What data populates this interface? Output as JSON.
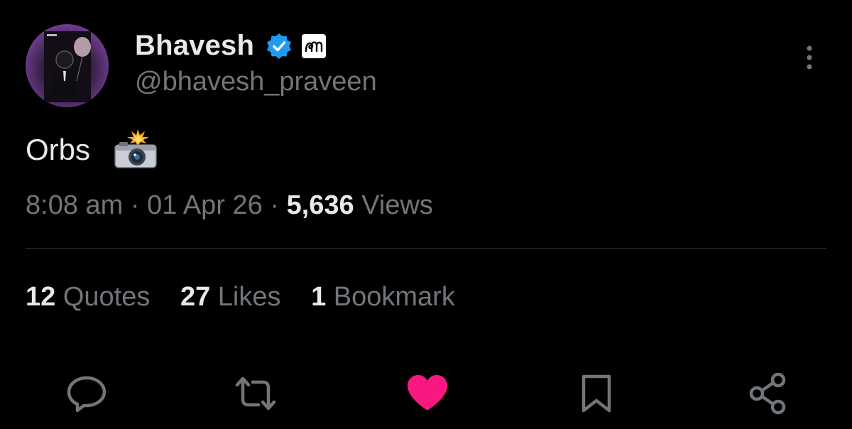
{
  "author": {
    "display_name": "Bhavesh",
    "handle": "@bhavesh_praveen",
    "verified": true,
    "avatar_icon": "avatar-astronaut-with-balloon"
  },
  "tweet": {
    "text": "Orbs",
    "emoji_icon": "camera-with-flash-icon",
    "time": "8:08 am",
    "date": "01 Apr 26",
    "views_count": "5,636",
    "views_label": "Views",
    "separator": "·"
  },
  "stats": {
    "quotes_count": "12",
    "quotes_label": "Quotes",
    "likes_count": "27",
    "likes_label": "Likes",
    "bookmarks_count": "1",
    "bookmarks_label": "Bookmark"
  },
  "actions": [
    "reply-icon",
    "retweet-icon",
    "like-icon",
    "bookmark-icon",
    "share-icon"
  ],
  "colors": {
    "background": "#000000",
    "text_primary": "#e7e9ea",
    "text_secondary": "#71767b",
    "verified": "#1d9bf0",
    "like_active": "#f91880",
    "divider": "#2f3336"
  }
}
